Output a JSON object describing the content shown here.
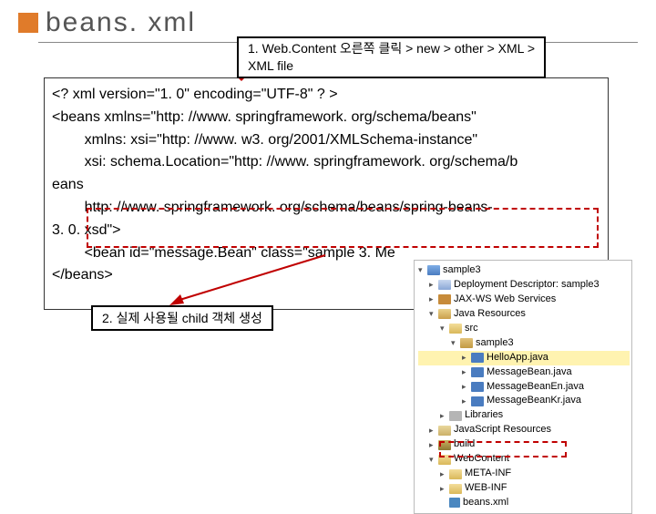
{
  "title": "beans. xml",
  "callout1_line1": "1. Web.Content 오른쪽 클릭 > new > other > XML >",
  "callout1_line2": "XML file",
  "callout2": "2. 실제 사용될 child 객체 생성",
  "code": "<? xml version=\"1. 0\" encoding=\"UTF-8\" ? >\n<beans xmlns=\"http: //www. springframework. org/schema/beans\"\n        xmlns: xsi=\"http: //www. w3. org/2001/XMLSchema-instance\"\n        xsi: schema.Location=\"http: //www. springframework. org/schema/b\neans\n        http: //www. springframework. org/schema/beans/spring-beans-\n3. 0. xsd\">\n        <bean id=\"message.Bean\" class=\"sample 3. Me\n</beans>",
  "tree": {
    "n0": "sample3",
    "n1": "Deployment Descriptor: sample3",
    "n2": "JAX-WS Web Services",
    "n3": "Java Resources",
    "n4": "src",
    "n5": "sample3",
    "n6": "HelloApp.java",
    "n7": "MessageBean.java",
    "n8": "MessageBeanEn.java",
    "n9": "MessageBeanKr.java",
    "n10": "Libraries",
    "n11": "JavaScript Resources",
    "n12": "build",
    "n13": "WebContent",
    "n14": "META-INF",
    "n15": "WEB-INF",
    "n16": "beans.xml"
  }
}
